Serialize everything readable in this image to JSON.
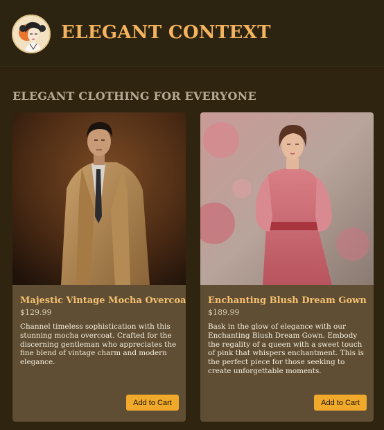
{
  "header": {
    "brand_name": "ELEGANT CONTEXT",
    "logo_icon": "vintage-woman-portrait"
  },
  "section": {
    "title": "ELEGANT CLOTHING FOR EVERYONE"
  },
  "products": [
    {
      "name": "Majestic Vintage Mocha Overcoat",
      "price": "$129.99",
      "description": "Channel timeless sophistication with this stunning mocha overcoat. Crafted for the discerning gentleman who appreciates the fine blend of vintage charm and modern elegance.",
      "button_label": "Add to Cart"
    },
    {
      "name": "Enchanting Blush Dream Gown",
      "price": "$189.99",
      "description": "Bask in the glow of elegance with our Enchanting Blush Dream Gown. Embody the regality of a queen with a sweet touch of pink that whispers enchantment. This is the perfect piece for those seeking to create unforgettable moments.",
      "button_label": "Add to Cart"
    }
  ],
  "colors": {
    "background": "#2e2410",
    "brand": "#f4b35e",
    "card": "#5f4e34",
    "accent_button": "#f0a92a",
    "product_name": "#f5c071"
  }
}
